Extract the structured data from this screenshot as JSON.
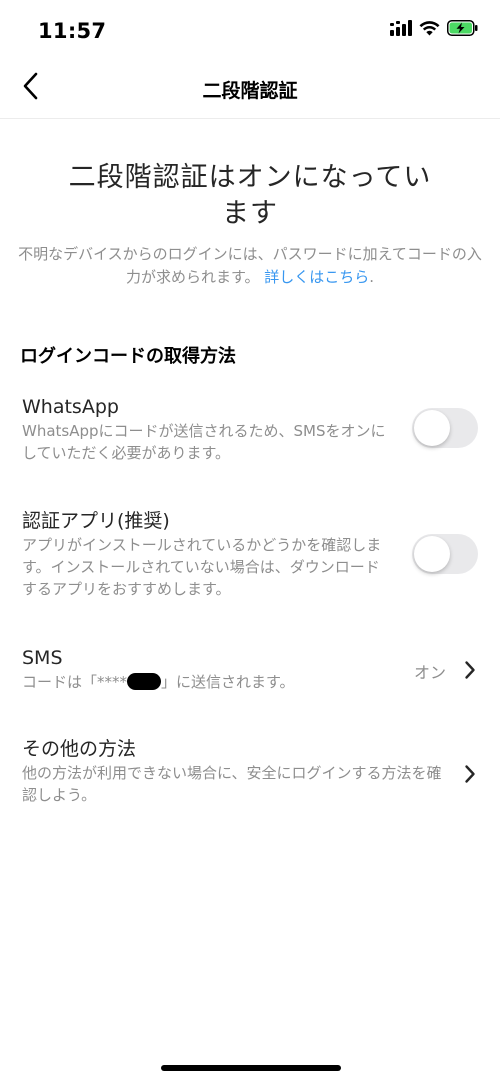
{
  "status_bar": {
    "time": "11:57",
    "icons": [
      "signal-icon",
      "wifi-icon",
      "battery-charging-icon"
    ]
  },
  "header": {
    "title": "二段階認証",
    "back_icon": "chevron-left-icon"
  },
  "hero": {
    "title": "二段階認証はオンになってい\nます",
    "description": "不明なデバイスからのログインには、パスワードに加えてコードの入力が求められます。",
    "learn_more": "詳しくはこちら",
    "period": "."
  },
  "section": {
    "title": "ログインコードの取得方法"
  },
  "options": {
    "whatsapp": {
      "title": "WhatsApp",
      "description": "WhatsAppにコードが送信されるため、SMSをオンにしていただく必要があります。",
      "enabled": false
    },
    "auth_app": {
      "title": "認証アプリ(推奨)",
      "description": "アプリがインストールされているかどうかを確認します。インストールされていない場合は、ダウンロードするアプリをおすすめします。",
      "enabled": false
    },
    "sms": {
      "title": "SMS",
      "description_prefix": "コードは「****",
      "description_suffix": "」に送信されます。",
      "value": "オン"
    },
    "other": {
      "title": "その他の方法",
      "description": "他の方法が利用できない場合に、安全にログインする方法を確認しよう。"
    }
  },
  "colors": {
    "link": "#3897f0",
    "secondary_text": "#8e8e8e",
    "toggle_off": "#e9e9eb",
    "battery_charging": "#4cd964"
  }
}
